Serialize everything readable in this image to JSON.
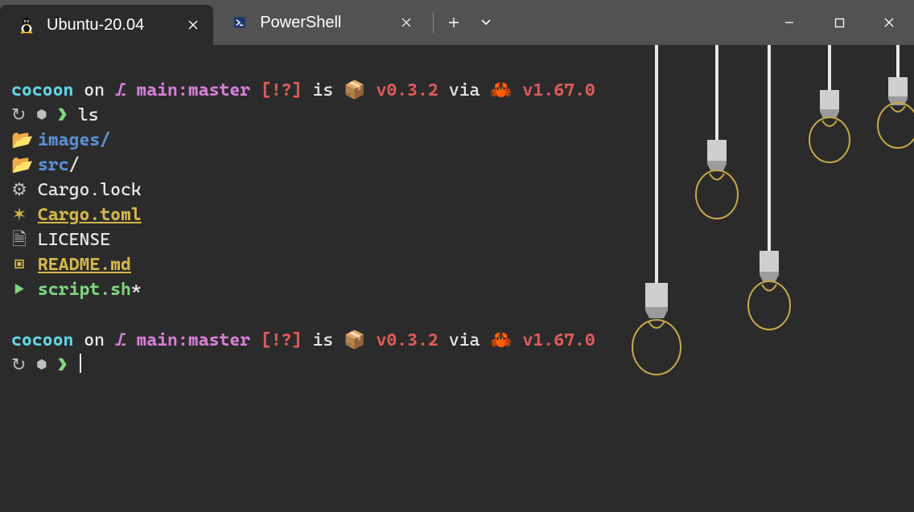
{
  "titlebar": {
    "tabs": [
      {
        "label": "Ubuntu-20.04",
        "icon": "tux"
      },
      {
        "label": "PowerShell",
        "icon": "pwsh"
      }
    ],
    "new_tab_tooltip": "+",
    "dropdown_tooltip": "˅"
  },
  "prompt": {
    "dir": "cocoon",
    "on": "on",
    "branch_icon": "⎇",
    "branch": "main:master",
    "git_status": "[!?]",
    "is": "is",
    "pkg_emoji": "📦",
    "pkg_version": "v0.3.2",
    "via": "via",
    "lang_emoji": "🦀",
    "lang_version": "v1.67.0",
    "os_icon": "↻",
    "shell_icon": "⬢",
    "caret": "❯"
  },
  "cmd1": "ls",
  "ls": [
    {
      "icon": "📂",
      "name": "images",
      "suffix": "/",
      "class": "blue bold"
    },
    {
      "icon": "📂",
      "name": "src",
      "suffix": "/",
      "class": "blue bold",
      "suffixClass": "white"
    },
    {
      "icon": "⚙",
      "name": "Cargo.lock",
      "suffix": "",
      "class": "white"
    },
    {
      "icon": "✶",
      "name": "Cargo.toml",
      "suffix": "",
      "class": "yellow und bold"
    },
    {
      "icon": "🗎",
      "name": "LICENSE",
      "suffix": "",
      "class": "white"
    },
    {
      "icon": "▣",
      "name": "README.md",
      "suffix": "",
      "class": "yellow und bold"
    },
    {
      "icon": "▶",
      "name": "script.sh",
      "suffix": "*",
      "class": "green bold",
      "suffixClass": "white"
    }
  ]
}
